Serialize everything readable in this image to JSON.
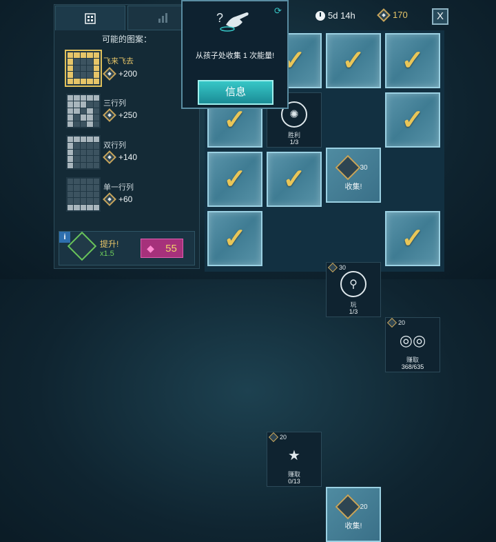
{
  "tabs": [
    {
      "icon": "dice-pattern-icon"
    },
    {
      "icon": "bar-chart-icon"
    }
  ],
  "patterns_panel": {
    "title": "可能的图案：",
    "patterns": [
      {
        "name": "飞来飞去",
        "reward": "+200",
        "selected": true
      },
      {
        "name": "三行列",
        "reward": "+250",
        "selected": false
      },
      {
        "name": "双行列",
        "reward": "+140",
        "selected": false
      },
      {
        "name": "单一行列",
        "reward": "+60",
        "selected": false
      }
    ]
  },
  "boost": {
    "info": "i",
    "title": "提升!",
    "multiplier": "x1.5",
    "gem_cost": "55"
  },
  "header": {
    "timer": "5d 14h",
    "coins": "170",
    "close": "X"
  },
  "popup": {
    "text": "从孩子处收集 1 次能量!",
    "button": "信息"
  },
  "board": {
    "tasks": [
      {
        "label": "胜利",
        "progress": "1/3"
      },
      {
        "label": "玩",
        "progress": "1/3",
        "cost": "30"
      },
      {
        "label": "赚取",
        "progress": "368/635",
        "cost": "20"
      },
      {
        "label": "赚取",
        "progress": "0/13",
        "cost": "20"
      }
    ],
    "collects": [
      {
        "value": "30",
        "label": "收集!"
      },
      {
        "value": "20",
        "label": "收集!"
      }
    ]
  },
  "colors": {
    "accent_gold": "#e7c568",
    "accent_teal": "#37c7c7",
    "gem_pink": "#a6317b"
  }
}
